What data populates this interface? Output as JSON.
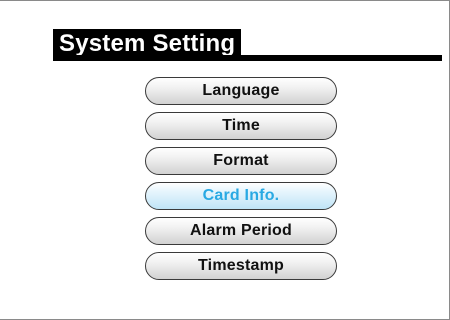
{
  "header": {
    "title": "System Setting"
  },
  "menu": {
    "selected_index": 3,
    "items": [
      {
        "label": "Language"
      },
      {
        "label": "Time"
      },
      {
        "label": "Format"
      },
      {
        "label": "Card Info."
      },
      {
        "label": "Alarm Period"
      },
      {
        "label": "Timestamp"
      }
    ]
  },
  "colors": {
    "selected_text": "#29a9e3",
    "title_background": "#000000",
    "title_text": "#ffffff"
  }
}
